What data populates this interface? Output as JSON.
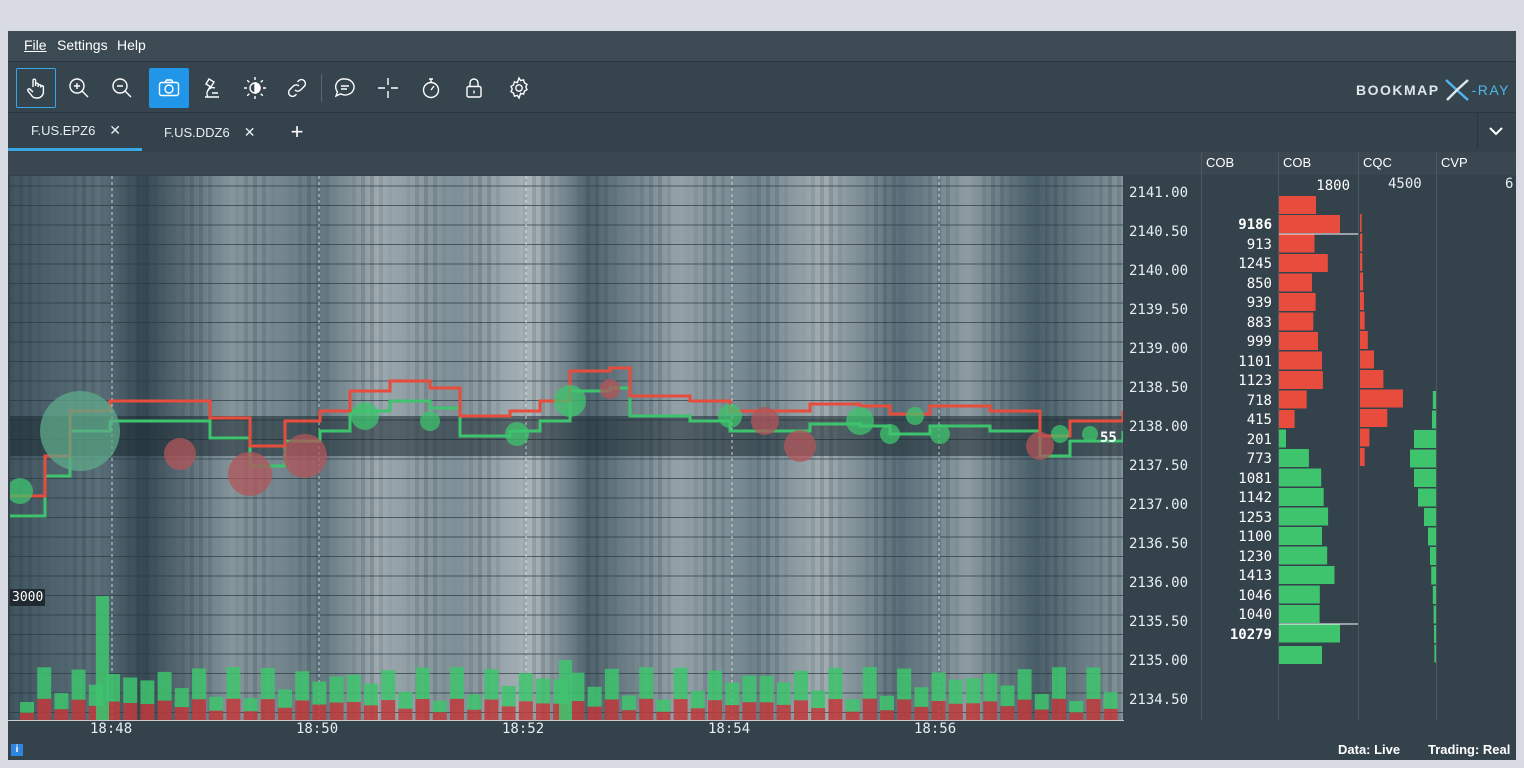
{
  "menu": {
    "file": "File",
    "settings": "Settings",
    "help": "Help"
  },
  "brand": {
    "name": "BOOKMAP",
    "x": "X",
    "ray": "-RAY"
  },
  "toolbar": [
    "hand-icon",
    "zoom-in-icon",
    "zoom-out-icon",
    "camera-icon",
    "microscope-icon",
    "brightness-icon",
    "link-icon",
    "chat-icon",
    "crosshair-icon",
    "stopwatch-icon",
    "lock-icon",
    "gear-icon"
  ],
  "tabs": [
    {
      "label": "F.US.EPZ6",
      "active": true
    },
    {
      "label": "F.US.DDZ6",
      "active": false
    }
  ],
  "columns": {
    "cob1": "COB",
    "cob2": "COB",
    "cqc": "CQC",
    "cvp": "CVP"
  },
  "column_scales": {
    "cob": "1800",
    "cqc": "4500",
    "cvp": "6"
  },
  "prices": [
    "2141.00",
    "2140.50",
    "2140.00",
    "2139.50",
    "2139.00",
    "2138.50",
    "2138.00",
    "2137.50",
    "2137.00",
    "2136.50",
    "2136.00",
    "2135.50",
    "2135.00",
    "2134.50"
  ],
  "cob_values": [
    {
      "value": "9186",
      "bold": true,
      "side": "ask"
    },
    {
      "value": "913",
      "side": "ask"
    },
    {
      "value": "1245",
      "side": "ask"
    },
    {
      "value": "850",
      "side": "ask"
    },
    {
      "value": "939",
      "side": "ask"
    },
    {
      "value": "883",
      "side": "ask"
    },
    {
      "value": "999",
      "side": "ask"
    },
    {
      "value": "1101",
      "side": "ask"
    },
    {
      "value": "1123",
      "side": "ask"
    },
    {
      "value": "718",
      "side": "ask"
    },
    {
      "value": "415",
      "side": "ask"
    },
    {
      "value": "201",
      "side": "bid"
    },
    {
      "value": "773",
      "side": "bid"
    },
    {
      "value": "1081",
      "side": "bid"
    },
    {
      "value": "1142",
      "side": "bid"
    },
    {
      "value": "1253",
      "side": "bid"
    },
    {
      "value": "1100",
      "side": "bid"
    },
    {
      "value": "1230",
      "side": "bid"
    },
    {
      "value": "1413",
      "side": "bid"
    },
    {
      "value": "1046",
      "side": "bid"
    },
    {
      "value": "1040",
      "side": "bid"
    },
    {
      "value": "10279",
      "bold": true,
      "side": "bid"
    }
  ],
  "cqc_levels": [
    {
      "side": "ask",
      "level": 0.02
    },
    {
      "side": "ask",
      "level": 0.03
    },
    {
      "side": "ask",
      "level": 0.03
    },
    {
      "side": "ask",
      "level": 0.04
    },
    {
      "side": "ask",
      "level": 0.05
    },
    {
      "side": "ask",
      "level": 0.06
    },
    {
      "side": "ask",
      "level": 0.1
    },
    {
      "side": "ask",
      "level": 0.18
    },
    {
      "side": "ask",
      "level": 0.3
    },
    {
      "side": "ask",
      "level": 0.55
    },
    {
      "side": "ask",
      "level": 0.35
    },
    {
      "side": "ask",
      "level": 0.12
    },
    {
      "side": "ask",
      "level": 0.06
    }
  ],
  "cvp_levels": [
    0.08,
    0.1,
    0.55,
    0.65,
    0.55,
    0.45,
    0.3,
    0.2,
    0.15,
    0.12,
    0.08,
    0.06,
    0.05,
    0.04
  ],
  "time_labels": [
    "18:48",
    "18:50",
    "18:52",
    "18:54",
    "18:56"
  ],
  "volume_marker": "3000",
  "last_trade_label": "55",
  "status": {
    "data": "Data: Live",
    "trading": "Trading: Real"
  },
  "colors": {
    "ask": "#e84c3d",
    "bid": "#3ec46d",
    "accent": "#2196e8",
    "bg": "#34424b"
  }
}
